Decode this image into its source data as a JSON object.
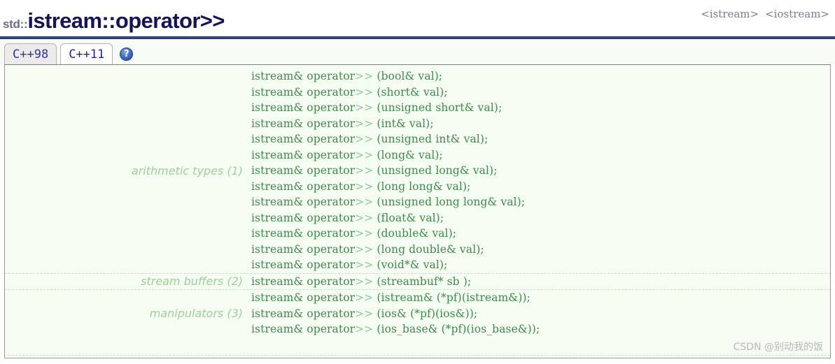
{
  "page": {
    "std_prefix": "std::",
    "title": "istream::operator>>",
    "headers": [
      "<istream>",
      "<iostream>"
    ],
    "accent_blue": "#2e4d8a",
    "panel_bg": "#f5fcf2",
    "sig_color": "#3f8a4d",
    "label_color": "#9ed09b"
  },
  "tabs": [
    {
      "label": "C++98",
      "active": false
    },
    {
      "label": "C++11",
      "active": true
    }
  ],
  "help": {
    "name": "help-icon",
    "glyph": "?"
  },
  "groups": [
    {
      "label": "arithmetic types (1)",
      "signatures": [
        {
          "prefix": "istream& operator",
          "op": ">>",
          "suffix": " (bool& val);"
        },
        {
          "prefix": "istream& operator",
          "op": ">>",
          "suffix": " (short& val);"
        },
        {
          "prefix": "istream& operator",
          "op": ">>",
          "suffix": " (unsigned short& val);"
        },
        {
          "prefix": "istream& operator",
          "op": ">>",
          "suffix": " (int& val);"
        },
        {
          "prefix": "istream& operator",
          "op": ">>",
          "suffix": " (unsigned int& val);"
        },
        {
          "prefix": "istream& operator",
          "op": ">>",
          "suffix": " (long& val);"
        },
        {
          "prefix": "istream& operator",
          "op": ">>",
          "suffix": " (unsigned long& val);"
        },
        {
          "prefix": "istream& operator",
          "op": ">>",
          "suffix": " (long long& val);"
        },
        {
          "prefix": "istream& operator",
          "op": ">>",
          "suffix": " (unsigned long long& val);"
        },
        {
          "prefix": "istream& operator",
          "op": ">>",
          "suffix": " (float& val);"
        },
        {
          "prefix": "istream& operator",
          "op": ">>",
          "suffix": " (double& val);"
        },
        {
          "prefix": "istream& operator",
          "op": ">>",
          "suffix": " (long double& val);"
        },
        {
          "prefix": "istream& operator",
          "op": ">>",
          "suffix": " (void*& val);"
        }
      ]
    },
    {
      "label": "stream buffers (2)",
      "signatures": [
        {
          "prefix": "istream& operator",
          "op": ">>",
          "suffix": " (streambuf* sb );"
        }
      ]
    },
    {
      "label": "manipulators (3)",
      "signatures": [
        {
          "prefix": "istream& operator",
          "op": ">>",
          "suffix": " (istream& (*pf)(istream&));"
        },
        {
          "prefix": "istream& operator",
          "op": ">>",
          "suffix": " (ios& (*pf)(ios&));"
        },
        {
          "prefix": "istream& operator",
          "op": ">>",
          "suffix": " (ios_base& (*pf)(ios_base&));"
        }
      ]
    }
  ],
  "watermark": "CSDN @别动我的饭"
}
